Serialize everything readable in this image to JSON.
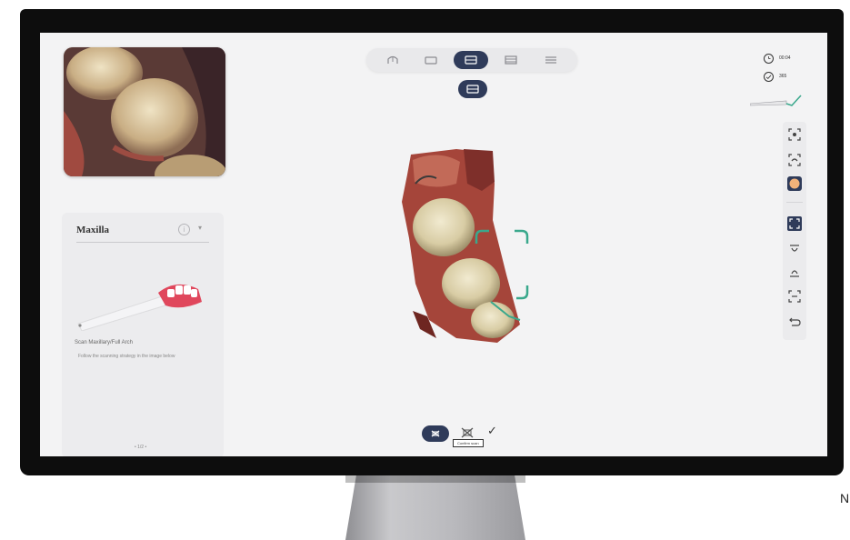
{
  "left_panel": {
    "title": "Maxilla",
    "instruction": "Scan Maxillary/Full Arch",
    "note": "Follow the scanning strategy in the image below",
    "page_indicator": "• 1/2 •"
  },
  "status": {
    "time": "00:04",
    "count": "365"
  },
  "top_toolbar": {
    "buttons": [
      "full-arch-icon",
      "jaw-icon",
      "scan-mode-icon",
      "bite-icon",
      "list-icon"
    ],
    "active_index": 2
  },
  "right_toolbar": {
    "icons": [
      "fit-view-icon",
      "reset-view-icon",
      "texture-icon",
      "focus-view-icon",
      "rotate-up-icon",
      "rotate-down-icon",
      "section-view-icon",
      "undo-icon"
    ]
  },
  "bottom_controls": {
    "tooltip": "Confirm scan"
  },
  "colors": {
    "accent": "#2f3b5a",
    "screen_bg": "#f3f3f4",
    "scan_frame": "#3aa88c",
    "bezel": "#0d0d0d"
  }
}
